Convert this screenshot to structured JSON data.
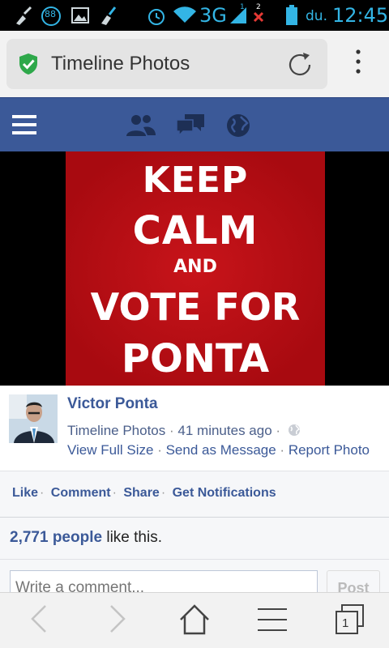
{
  "status_bar": {
    "notification_badge": "88",
    "network": "3G",
    "sim1": "1",
    "sim2": "2",
    "day": "du.",
    "time": "12:45"
  },
  "address_bar": {
    "title": "Timeline Photos",
    "secure_icon": "green-shield-check-icon",
    "reload_icon": "reload-icon",
    "menu_icon": "overflow-menu-icon"
  },
  "fb_nav": {
    "menu_icon": "hamburger-icon",
    "icons": [
      "friends-icon",
      "messages-icon",
      "globe-icon"
    ]
  },
  "photo": {
    "lines": [
      "KEEP",
      "CALM",
      "AND",
      "VOTE FOR",
      "PONTA"
    ],
    "background_color": "#b40b10"
  },
  "post": {
    "author": "Victor Ponta",
    "album": "Timeline Photos",
    "sep": "·",
    "time_ago": "41 minutes ago",
    "links": [
      "View Full Size",
      "Send as Message",
      "Report Photo"
    ]
  },
  "actions": {
    "like": "Like",
    "comment": "Comment",
    "share": "Share",
    "notifications": "Get Notifications"
  },
  "likes": {
    "count": "2,771 people",
    "suffix": " like this."
  },
  "comment": {
    "placeholder": "Write a comment...",
    "post_label": "Post"
  },
  "bottom_bar": {
    "tab_count": "1",
    "icons": [
      "back-icon",
      "forward-icon",
      "home-icon",
      "menu-icon",
      "tabs-icon"
    ]
  },
  "colors": {
    "facebook_blue": "#3b5998",
    "status_accent": "#33b5e5",
    "poster_red": "#b40b10"
  }
}
